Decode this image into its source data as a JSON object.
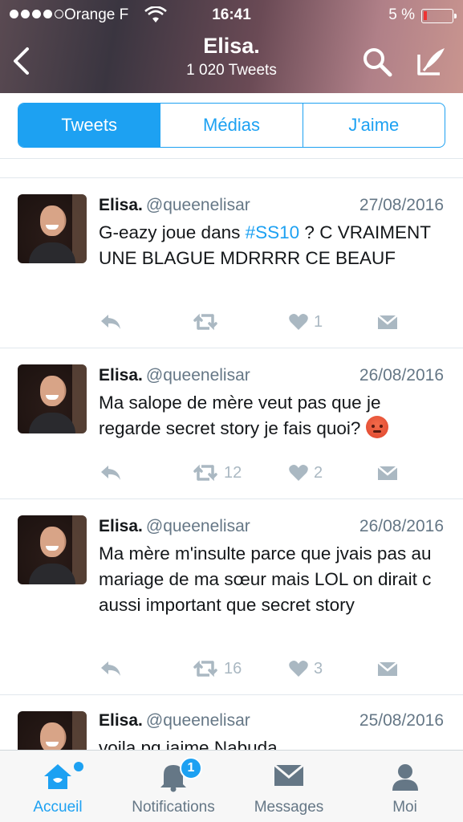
{
  "status_bar": {
    "carrier": "Orange F",
    "time": "16:41",
    "battery": "5 %"
  },
  "header": {
    "title": "Elisa.",
    "subtitle": "1 020 Tweets"
  },
  "tabs": [
    "Tweets",
    "Médias",
    "J'aime"
  ],
  "tweets": [
    {
      "name": "Elisa.",
      "handle": "@queenelisar",
      "date": "27/08/2016",
      "text_before": "G-eazy joue dans ",
      "hashtag": "#SS10",
      "text_after": " ? C VRAIMENT UNE BLAGUE MDRRRR CE BEAUF",
      "retweets": "",
      "likes": "1"
    },
    {
      "name": "Elisa.",
      "handle": "@queenelisar",
      "date": "26/08/2016",
      "text": "Ma salope de mère veut pas que je regarde secret story je fais quoi?",
      "emoji": "angry-face-emoji",
      "retweets": "12",
      "likes": "2"
    },
    {
      "name": "Elisa.",
      "handle": "@queenelisar",
      "date": "26/08/2016",
      "text": "Ma mère m'insulte parce que jvais pas au mariage de ma sœur mais LOL on dirait c aussi important que secret story",
      "retweets": "16",
      "likes": "3"
    },
    {
      "name": "Elisa.",
      "handle": "@queenelisar",
      "date": "25/08/2016",
      "text": "voila pq jaime Nabuda"
    }
  ],
  "tabbar": {
    "home": "Accueil",
    "notifications": "Notifications",
    "notifications_badge": "1",
    "messages": "Messages",
    "me": "Moi"
  },
  "colors": {
    "accent": "#1da1f2",
    "action_gray": "#aab8c2",
    "secondary_text": "#657786"
  }
}
